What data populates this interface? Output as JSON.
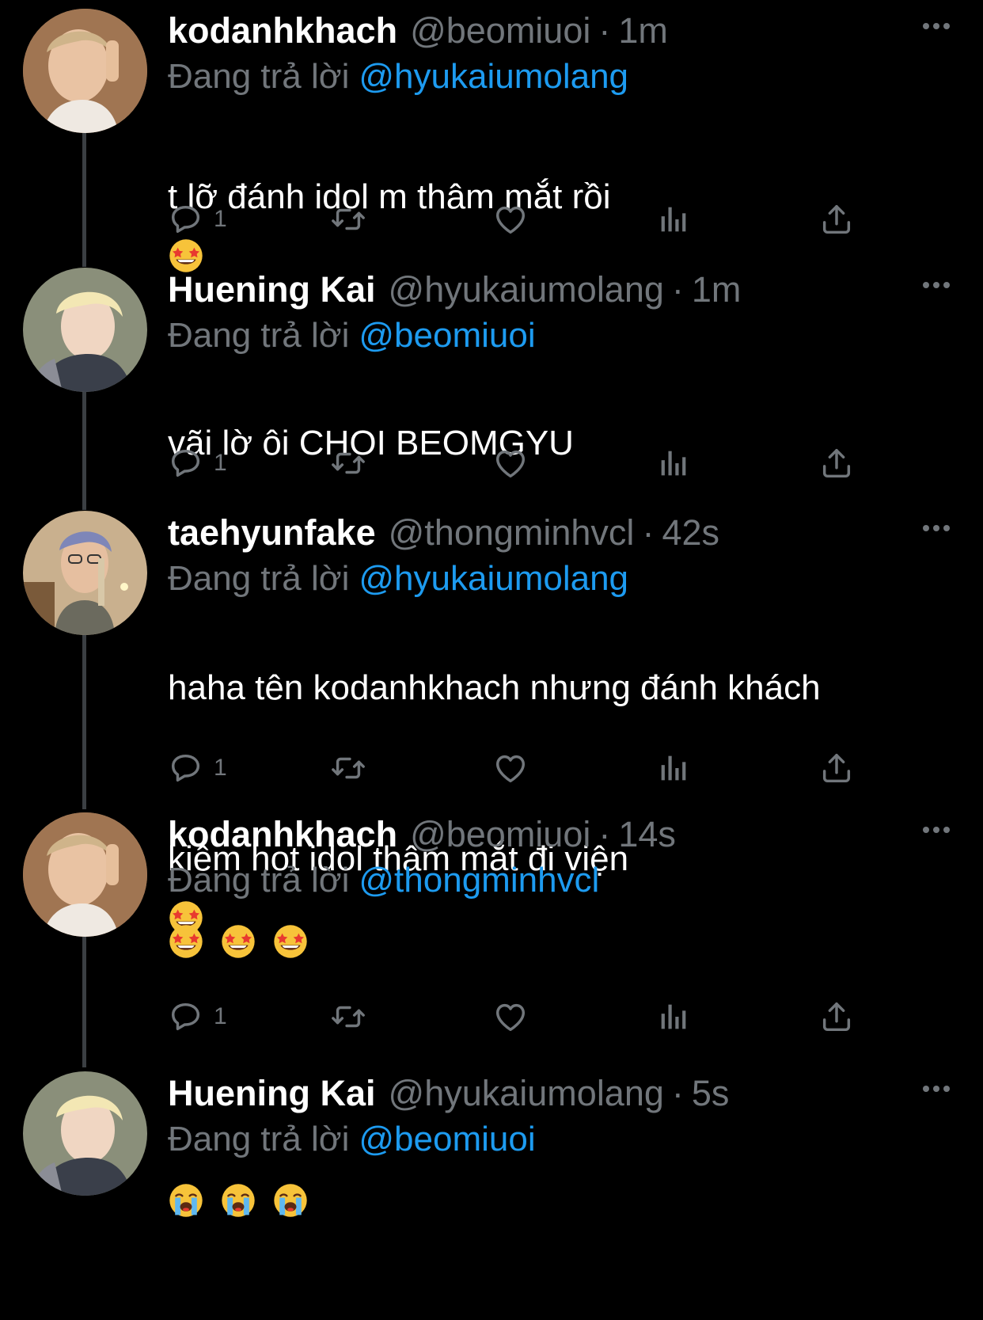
{
  "colors": {
    "background": "#000000",
    "text_primary": "#ffffff",
    "text_secondary": "#71767b",
    "mention": "#1d9bf0",
    "thread_line": "#3b3f43"
  },
  "replying_label": "Đang trả lời",
  "tweets": [
    {
      "name": "kodanhkhach",
      "handle": "@beomiuoi",
      "separator": "·",
      "time": "1m",
      "reply_to": "@hyukaiumolang",
      "text": "t lỡ đánh idol m thâm mắt rồi",
      "emoji": [
        "star-struck"
      ],
      "reply_count": "1",
      "avatar": "avatar-kodanhkhach"
    },
    {
      "name": "Huening Kai",
      "handle": "@hyukaiumolang",
      "separator": "·",
      "time": "1m",
      "reply_to": "@beomiuoi",
      "text": "vãi lờ ôi CHOI BEOMGYU",
      "emoji": [],
      "reply_count": "1",
      "avatar": "avatar-huening-kai"
    },
    {
      "name": "taehyunfake",
      "handle": "@thongminhvcl",
      "separator": "·",
      "time": "42s",
      "reply_to": "@hyukaiumolang",
      "text_line1": "haha tên kodanhkhach nhưng đánh khách",
      "text_line2": "kiêm hot idol thâm mắt đi viện",
      "emoji": [
        "star-struck"
      ],
      "reply_count": "1",
      "avatar": "avatar-taehyunfake"
    },
    {
      "name": "kodanhkhach",
      "handle": "@beomiuoi",
      "separator": "·",
      "time": "14s",
      "reply_to": "@thongminhvcl",
      "text": "",
      "emoji": [
        "star-struck",
        "star-struck",
        "star-struck"
      ],
      "reply_count": "1",
      "avatar": "avatar-kodanhkhach"
    },
    {
      "name": "Huening Kai",
      "handle": "@hyukaiumolang",
      "separator": "·",
      "time": "5s",
      "reply_to": "@beomiuoi",
      "text": "",
      "emoji": [
        "loudly-crying",
        "loudly-crying",
        "loudly-crying"
      ],
      "avatar": "avatar-huening-kai"
    }
  ],
  "action_icons": [
    "reply-icon",
    "retweet-icon",
    "like-icon",
    "analytics-icon",
    "share-icon"
  ]
}
